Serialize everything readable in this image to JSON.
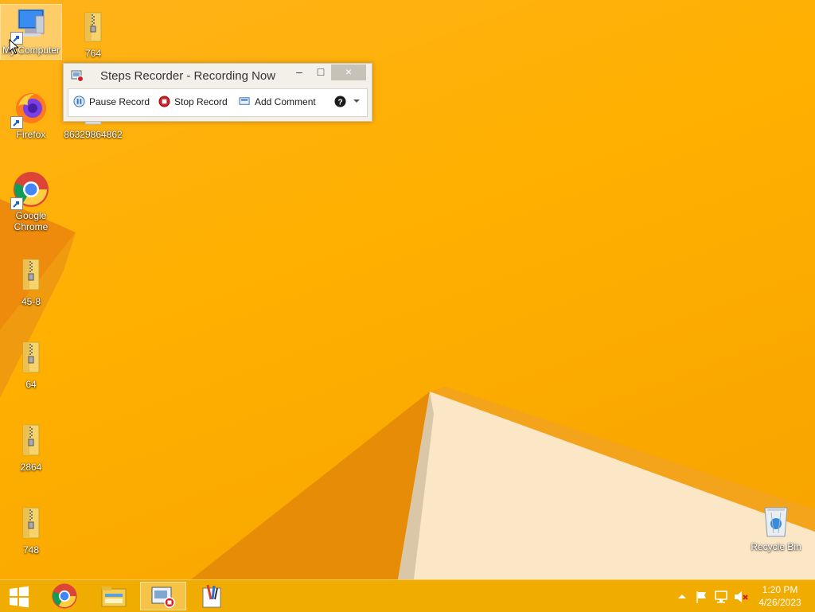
{
  "desktop": {
    "icons": [
      {
        "label": "My Computer",
        "icon": "computer-icon"
      },
      {
        "label": "764",
        "icon": "zip-folder-icon"
      },
      {
        "label": "Firefox",
        "icon": "firefox-icon"
      },
      {
        "label": "86329864862",
        "icon": "file-icon"
      },
      {
        "label": "Google Chrome",
        "icon": "chrome-icon"
      },
      {
        "label": "45-8",
        "icon": "zip-folder-icon"
      },
      {
        "label": "64",
        "icon": "zip-folder-icon"
      },
      {
        "label": "2864",
        "icon": "zip-folder-icon"
      },
      {
        "label": "748",
        "icon": "zip-folder-icon"
      },
      {
        "label": "Recycle Bin",
        "icon": "recycle-bin-icon"
      }
    ]
  },
  "steps_recorder": {
    "title": "Steps Recorder - Recording Now",
    "minimize": "–",
    "maximize": "□",
    "close": "×",
    "pause_label": "Pause Record",
    "stop_label": "Stop Record",
    "comment_label": "Add Comment",
    "help_icon": "help-icon",
    "dropdown_icon": "chevron-down-icon"
  },
  "taskbar": {
    "start_icon": "windows-logo-icon",
    "pinned": [
      {
        "name": "Google Chrome",
        "icon": "chrome-icon"
      },
      {
        "name": "File Explorer",
        "icon": "file-explorer-icon"
      },
      {
        "name": "Steps Recorder",
        "icon": "steps-recorder-icon"
      },
      {
        "name": "Paint",
        "icon": "paint-icon"
      }
    ],
    "tray_icons": [
      "show-hidden-icons-icon",
      "action-center-flag-icon",
      "network-icon",
      "speaker-muted-icon"
    ],
    "time": "1:20 PM",
    "date": "4/26/2023"
  },
  "colors": {
    "background": "#ffb000",
    "taskbar": "#f0ac00",
    "stop_red": "#d21f26",
    "pause_blue": "#2f6fb5"
  }
}
